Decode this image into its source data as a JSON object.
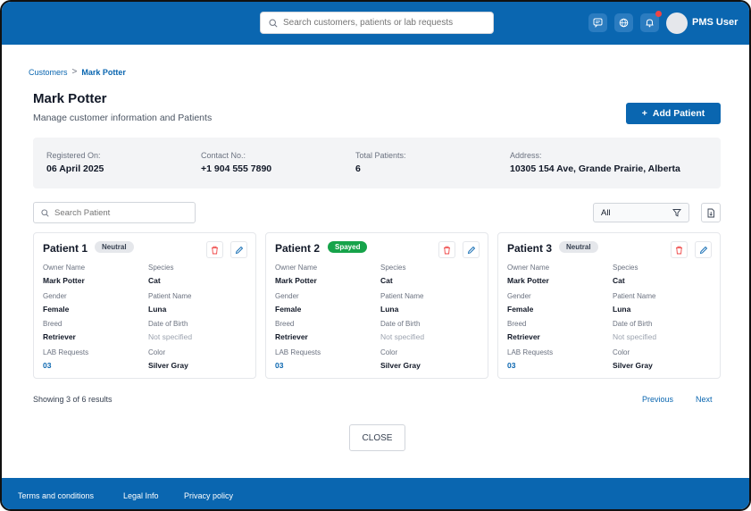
{
  "header": {
    "search_placeholder": "Search customers, patients or lab requests",
    "user_name": "PMS User"
  },
  "breadcrumb": {
    "parent": "Customers",
    "separator": ">",
    "current": "Mark Potter"
  },
  "page": {
    "title": "Mark Potter",
    "subtitle": "Manage customer information and Patients",
    "add_button_icon": "+",
    "add_button_label": "Add Patient"
  },
  "info": {
    "registered_label": "Registered On:",
    "registered_value": "06 April 2025",
    "contact_label": "Contact No.:",
    "contact_value": "+1 904 555 7890",
    "patients_label": "Total Patients:",
    "patients_value": "6",
    "address_label": "Address:",
    "address_value": "10305 154 Ave, Grande Prairie, Alberta"
  },
  "filters": {
    "search_placeholder": "Search Patient",
    "select_value": "All"
  },
  "field_labels": {
    "owner": "Owner Name",
    "species": "Species",
    "gender": "Gender",
    "patient_name": "Patient Name",
    "breed": "Breed",
    "dob": "Date of Birth",
    "lab": "LAB Requests",
    "color": "Color"
  },
  "patients": [
    {
      "title": "Patient 1",
      "status": "Neutral",
      "owner": "Mark Potter",
      "species": "Cat",
      "gender": "Female",
      "patient_name": "Luna",
      "breed": "Retriever",
      "dob": "Not specified",
      "lab": "03",
      "color": "Silver Gray"
    },
    {
      "title": "Patient 2",
      "status": "Spayed",
      "owner": "Mark Potter",
      "species": "Cat",
      "gender": "Female",
      "patient_name": "Luna",
      "breed": "Retriever",
      "dob": "Not specified",
      "lab": "03",
      "color": "Silver Gray"
    },
    {
      "title": "Patient 3",
      "status": "Neutral",
      "owner": "Mark Potter",
      "species": "Cat",
      "gender": "Female",
      "patient_name": "Luna",
      "breed": "Retriever",
      "dob": "Not specified",
      "lab": "03",
      "color": "Silver Gray"
    }
  ],
  "pagination": {
    "results_text": "Showing 3 of 6 results",
    "previous": "Previous",
    "next": "Next"
  },
  "close_label": "CLOSE",
  "footer": {
    "terms": "Terms and conditions",
    "legal": "Legal Info",
    "privacy": "Privacy policy"
  },
  "colors": {
    "primary": "#0a66b0",
    "spayed_badge": "#16a34a",
    "neutral_badge": "#e5e7eb",
    "delete_icon": "#ef4444",
    "notification_dot": "#ef4444"
  },
  "icons": [
    "search-icon",
    "chat-icon",
    "globe-icon",
    "bell-icon",
    "filter-icon",
    "export-icon",
    "trash-icon",
    "pencil-icon"
  ]
}
